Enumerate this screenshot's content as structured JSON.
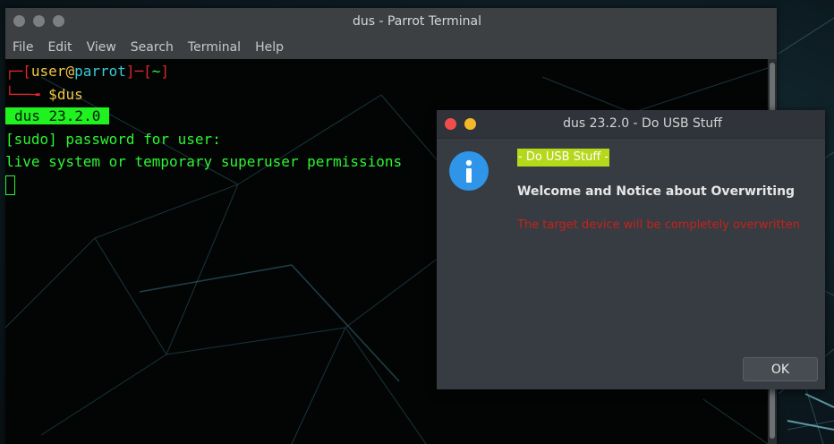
{
  "terminal": {
    "title": "dus - Parrot Terminal",
    "menu": [
      "File",
      "Edit",
      "View",
      "Search",
      "Terminal",
      "Help"
    ],
    "prompt": {
      "bracket_open": "┌─[",
      "user": "user",
      "at": "@",
      "host": "parrot",
      "bracket_mid": "]─[",
      "dir": "~",
      "bracket_close": "]",
      "arrow": "└──╼ ",
      "dollar": "$",
      "command": "dus"
    },
    "badge": "dus 23.2.0",
    "line_sudo": "[sudo] password for user:",
    "line_live": "live system or temporary superuser permissions"
  },
  "dialog": {
    "title": "dus 23.2.0 - Do USB Stuff",
    "icon": "info-icon",
    "heading": "- Do USB Stuff -",
    "welcome": "Welcome and Notice about Overwriting",
    "warning": "The target device will be completely overwritten",
    "ok_label": "OK"
  },
  "colors": {
    "prompt_red": "#e0242a",
    "prompt_yellow": "#f2c744",
    "prompt_cyan": "#39c9d6",
    "terminal_green": "#2df532",
    "heading_highlight": "#b5d81b",
    "warning_red": "#c4241c",
    "info_blue": "#2f95e8",
    "close_red": "#f14d4d",
    "minimize_yellow": "#f5b72a"
  }
}
